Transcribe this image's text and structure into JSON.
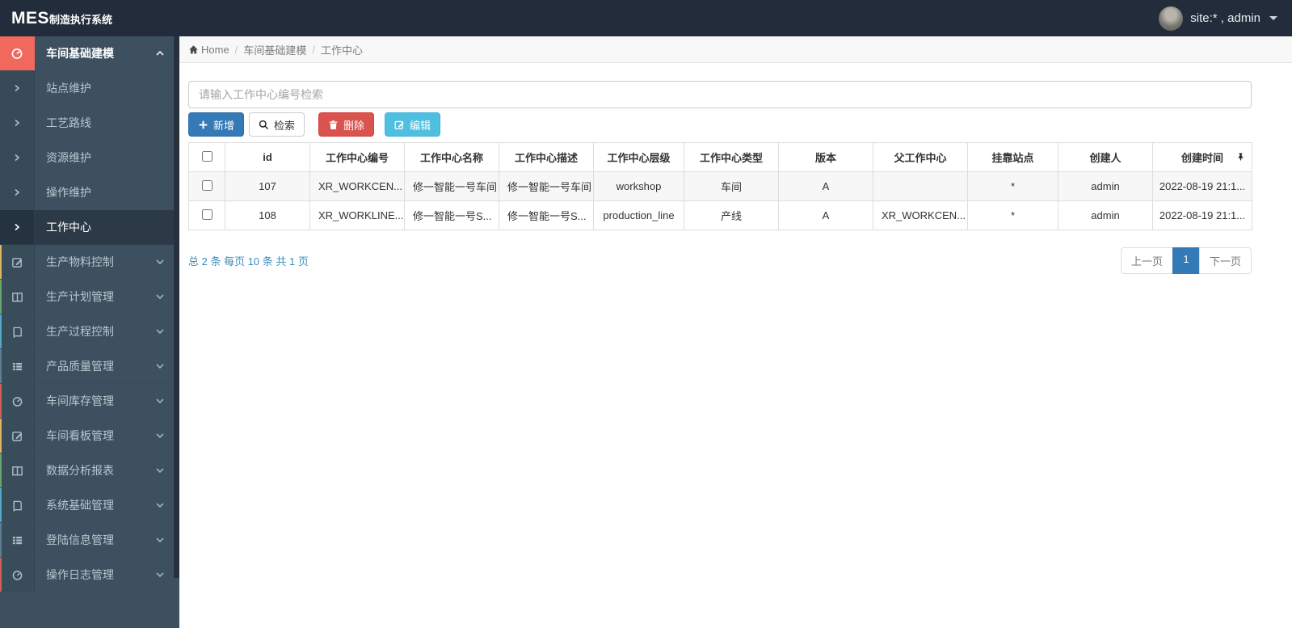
{
  "topbar": {
    "brand_bold": "MES",
    "brand_rest": "制造执行系统",
    "user_label": "site:* , admin"
  },
  "breadcrumb": {
    "home": "Home",
    "sep": "/",
    "level1": "车间基础建模",
    "level2": "工作中心"
  },
  "sidebar": {
    "parent": {
      "label": "车间基础建模",
      "icon": "tachometer-icon"
    },
    "sub_items": [
      {
        "label": "站点维护"
      },
      {
        "label": "工艺路线"
      },
      {
        "label": "资源维护"
      },
      {
        "label": "操作维护"
      },
      {
        "label": "工作中心",
        "active": true
      }
    ],
    "items": [
      {
        "label": "生产物料控制",
        "icon": "pencil-square-icon",
        "strip": "#e0b55e"
      },
      {
        "label": "生产计划管理",
        "icon": "columns-icon",
        "strip": "#6aa66a"
      },
      {
        "label": "生产过程控制",
        "icon": "book-icon",
        "strip": "#54a7c6"
      },
      {
        "label": "产品质量管理",
        "icon": "list-icon",
        "strip": "#5f7d93"
      },
      {
        "label": "车间库存管理",
        "icon": "tachometer-icon",
        "strip": "#d25f58"
      },
      {
        "label": "车间看板管理",
        "icon": "pencil-square-icon",
        "strip": "#e0b55e"
      },
      {
        "label": "数据分析报表",
        "icon": "columns-icon",
        "strip": "#6aa66a"
      },
      {
        "label": "系统基础管理",
        "icon": "book-icon",
        "strip": "#54a7c6"
      },
      {
        "label": "登陆信息管理",
        "icon": "list-icon",
        "strip": "#5f7d93"
      },
      {
        "label": "操作日志管理",
        "icon": "tachometer-icon",
        "strip": "#d25f58"
      }
    ]
  },
  "toolbar": {
    "search_placeholder": "请输入工作中心编号检索",
    "add_label": "新增",
    "search_label": "检索",
    "delete_label": "删除",
    "edit_label": "编辑"
  },
  "table": {
    "headers": [
      "id",
      "工作中心编号",
      "工作中心名称",
      "工作中心描述",
      "工作中心层级",
      "工作中心类型",
      "版本",
      "父工作中心",
      "挂靠站点",
      "创建人",
      "创建时间"
    ],
    "rows": [
      {
        "cells": [
          "107",
          "XR_WORKCEN...",
          "修一智能一号车间",
          "修一智能一号车间",
          "workshop",
          "车间",
          "A",
          "",
          "*",
          "admin",
          "2022-08-19 21:1..."
        ]
      },
      {
        "cells": [
          "108",
          "XR_WORKLINE...",
          "修一智能一号S...",
          "修一智能一号S...",
          "production_line",
          "产线",
          "A",
          "XR_WORKCEN...",
          "*",
          "admin",
          "2022-08-19 21:1..."
        ]
      }
    ]
  },
  "pagination": {
    "summary": "总 2 条 每页 10 条 共 1 页",
    "prev": "上一页",
    "current": "1",
    "next": "下一页"
  },
  "colors": {
    "topbar_bg": "#222c3a",
    "sidebar_bg": "#3d5060",
    "sidebar_active_bg": "#2b3a46",
    "parent_icon_block": "#f0695c",
    "primary_blue": "#337ab7",
    "danger_red": "#d9534f",
    "info_cyan": "#4fbfe0",
    "link_blue": "#3c8dbc"
  }
}
